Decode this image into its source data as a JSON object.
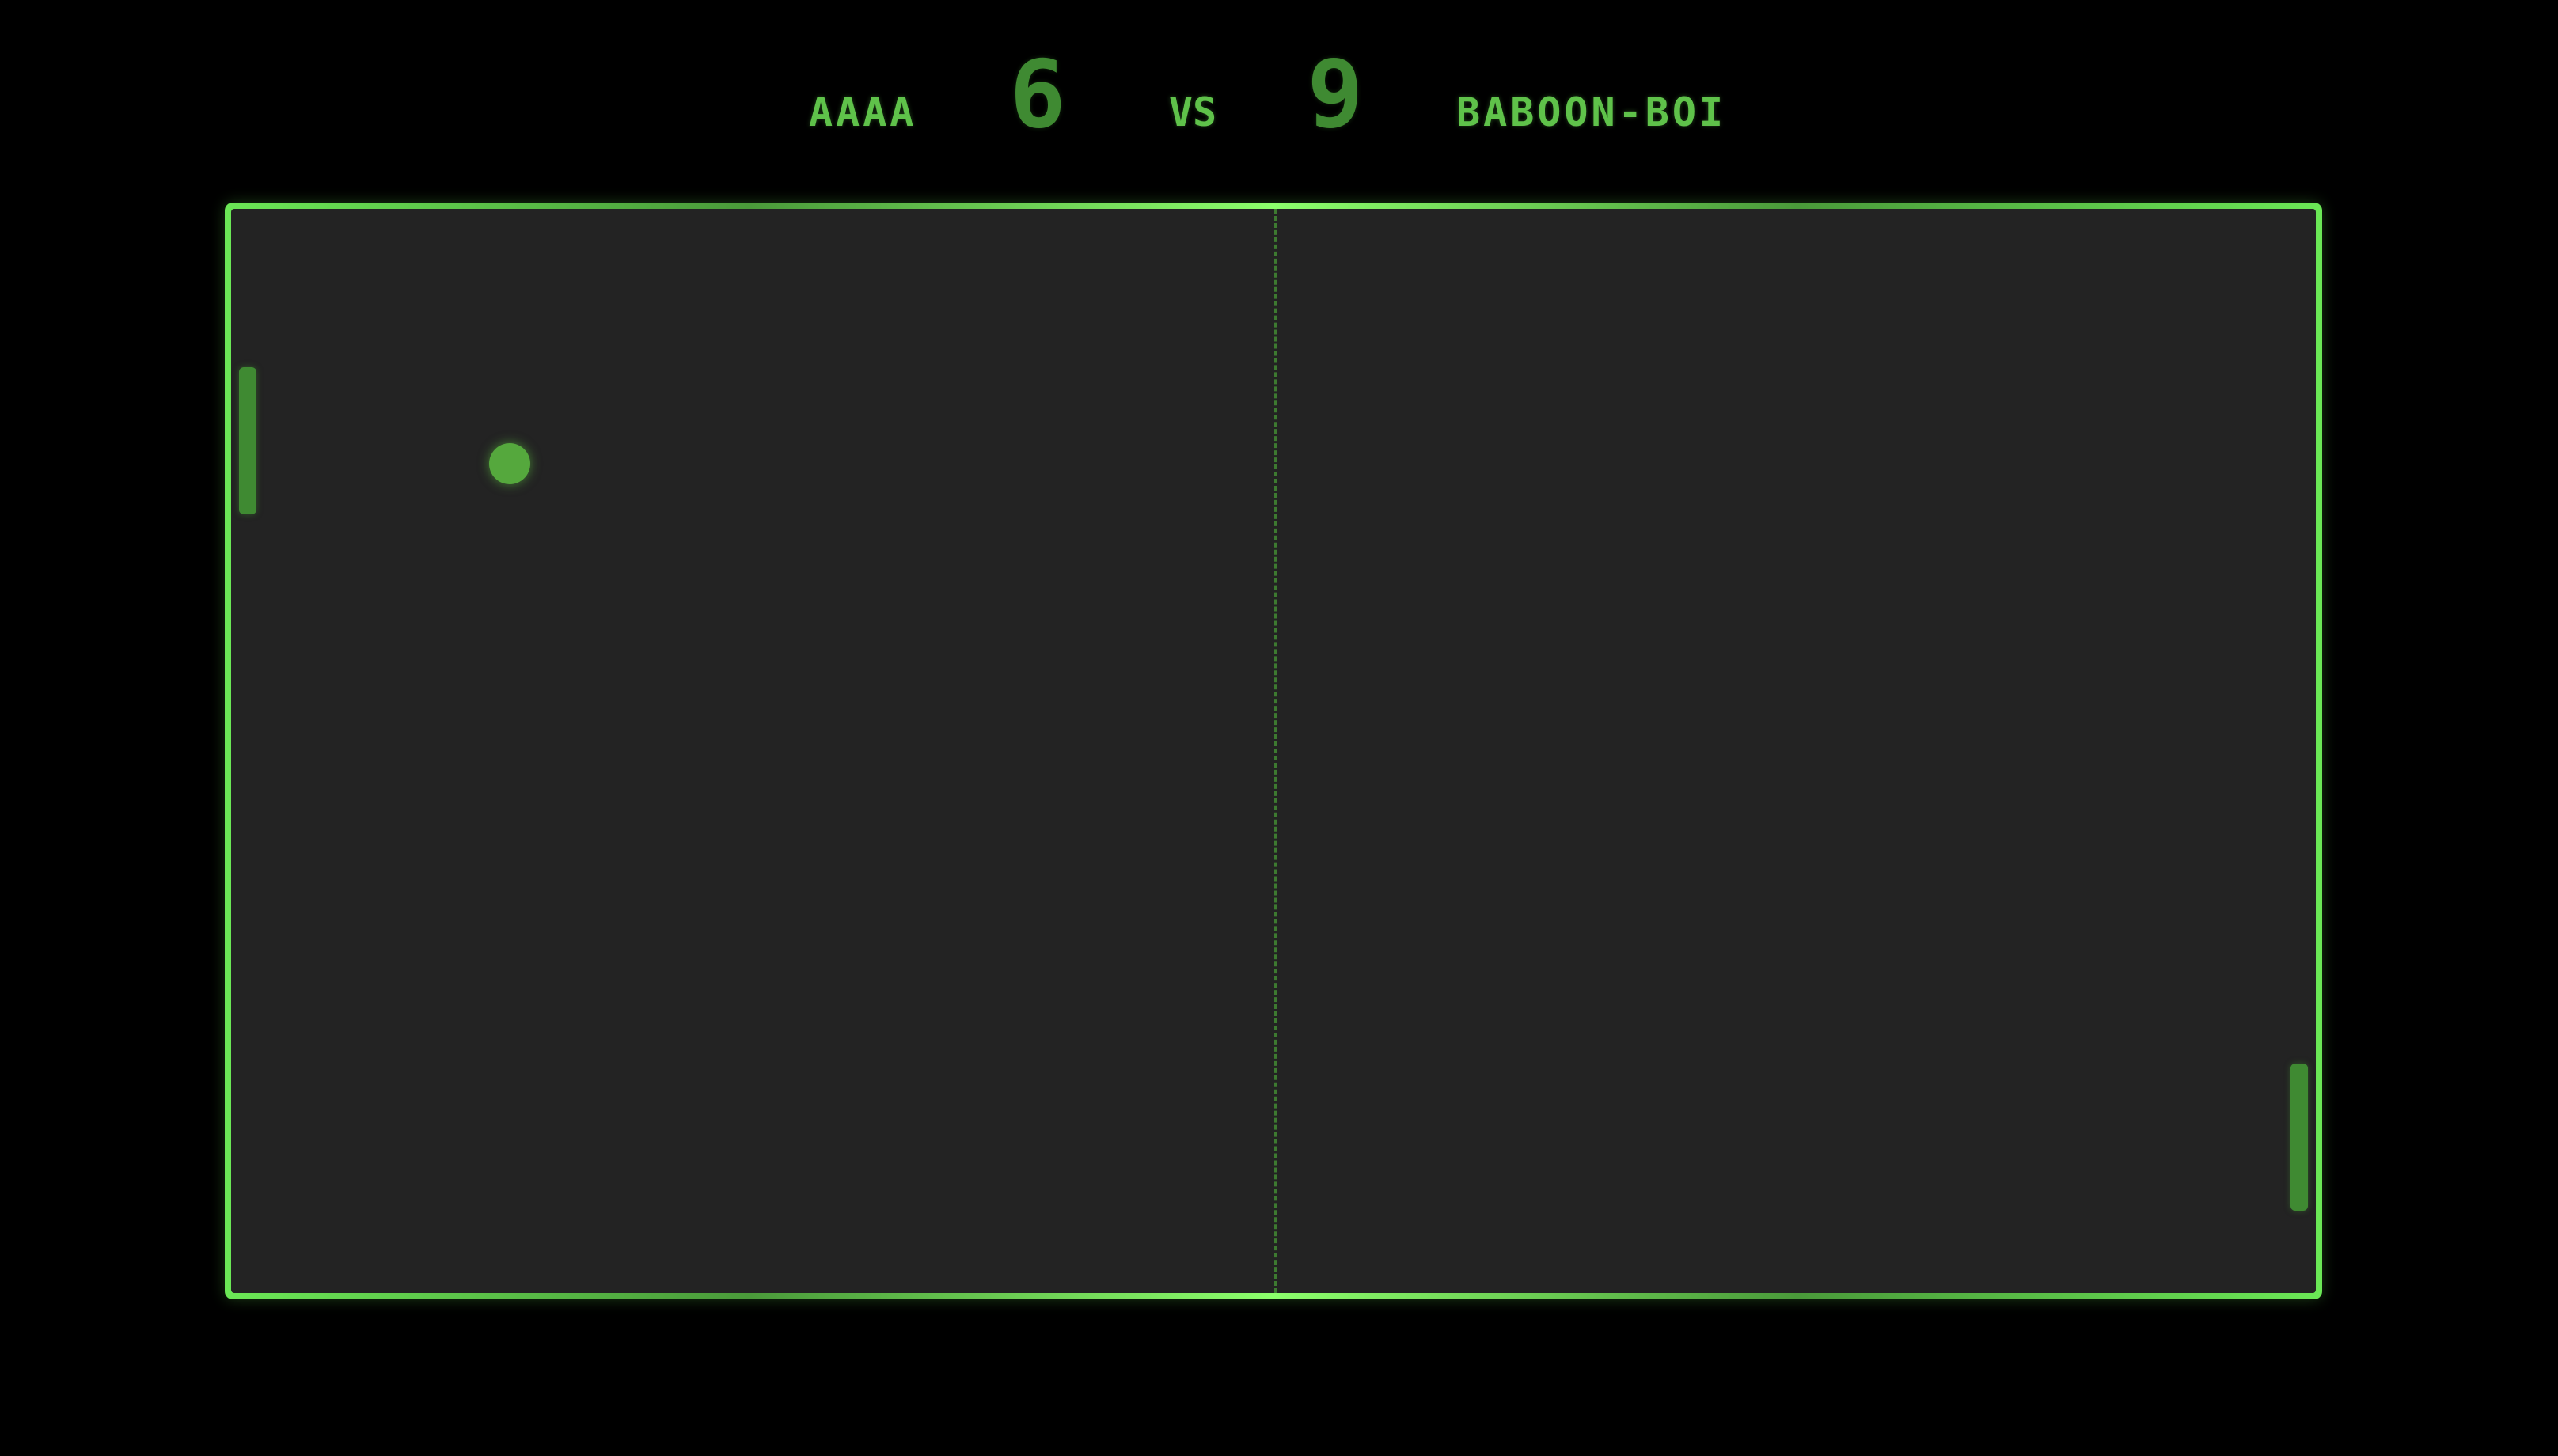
{
  "scoreboard": {
    "left_player": {
      "name": "AAAA",
      "score": "6"
    },
    "vs_label": "VS",
    "right_player": {
      "name": "BABOON-BOI",
      "score": "9"
    }
  },
  "colors": {
    "background": "#000000",
    "field": "#232323",
    "accent": "#6be856",
    "paddle": "#3f8a32",
    "ball": "#55a83d"
  }
}
